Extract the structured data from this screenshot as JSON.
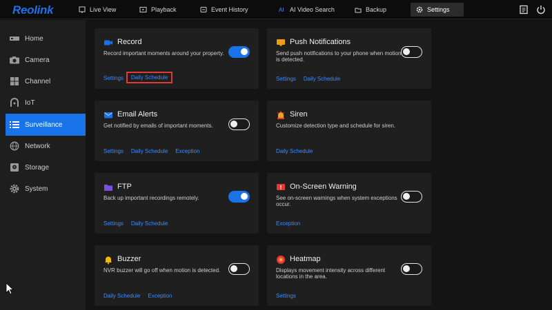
{
  "app": {
    "logo": "Reolink"
  },
  "nav": {
    "tabs": [
      {
        "label": "Live View",
        "icon": "monitor-icon"
      },
      {
        "label": "Playback",
        "icon": "playback-icon"
      },
      {
        "label": "Event History",
        "icon": "event-history-icon"
      },
      {
        "label": "AI Video Search",
        "icon": "ai-search-icon"
      },
      {
        "label": "Backup",
        "icon": "backup-icon"
      },
      {
        "label": "Settings",
        "icon": "gear-icon",
        "active": true
      }
    ]
  },
  "sidebar": {
    "items": [
      {
        "label": "Home",
        "icon": "home-icon"
      },
      {
        "label": "Camera",
        "icon": "camera-icon"
      },
      {
        "label": "Channel",
        "icon": "channel-icon"
      },
      {
        "label": "IoT",
        "icon": "iot-icon"
      },
      {
        "label": "Surveillance",
        "icon": "list-icon",
        "active": true
      },
      {
        "label": "Network",
        "icon": "globe-icon"
      },
      {
        "label": "Storage",
        "icon": "storage-icon"
      },
      {
        "label": "System",
        "icon": "gear-icon"
      }
    ]
  },
  "cards": [
    {
      "title": "Record",
      "desc": "Record important moments around your property.",
      "enabled": true,
      "icon": "video-camera-icon",
      "icon_color": "#1a72e8",
      "links": [
        "Settings",
        "Daily Schedule"
      ]
    },
    {
      "title": "Push Notifications",
      "desc": "Send push notifications to your phone when motion is detected.",
      "enabled": false,
      "icon": "notification-icon",
      "icon_color": "#f39c12",
      "links": [
        "Settings",
        "Daily Schedule"
      ]
    },
    {
      "title": "Email Alerts",
      "desc": "Get notified by emails of important moments.",
      "enabled": false,
      "icon": "email-icon",
      "icon_color": "#1a72e8",
      "links": [
        "Settings",
        "Daily Schedule",
        "Exception"
      ]
    },
    {
      "title": "Siren",
      "desc": "Customize detection type and schedule for siren.",
      "enabled": null,
      "icon": "siren-icon",
      "icon_color": "#f0a020",
      "links": [
        "Daily Schedule"
      ]
    },
    {
      "title": "FTP",
      "desc": "Back up important recordings remotely.",
      "enabled": true,
      "icon": "folder-icon",
      "icon_color": "#7a4fe0",
      "links": [
        "Settings",
        "Daily Schedule"
      ]
    },
    {
      "title": "On-Screen Warning",
      "desc": "See on-screen warnings when system exceptions occur.",
      "enabled": false,
      "icon": "warning-screen-icon",
      "icon_color": "#e53935",
      "links": [
        "Exception"
      ]
    },
    {
      "title": "Buzzer",
      "desc": "NVR buzzer will go off when motion is detected.",
      "enabled": false,
      "icon": "bell-icon",
      "icon_color": "#f5b800",
      "links": [
        "Daily Schedule",
        "Exception"
      ]
    },
    {
      "title": "Heatmap",
      "desc": "Displays movement intensity across different locations in the area.",
      "enabled": false,
      "icon": "heatmap-icon",
      "icon_color": "#e53935",
      "links": [
        "Settings"
      ]
    }
  ]
}
